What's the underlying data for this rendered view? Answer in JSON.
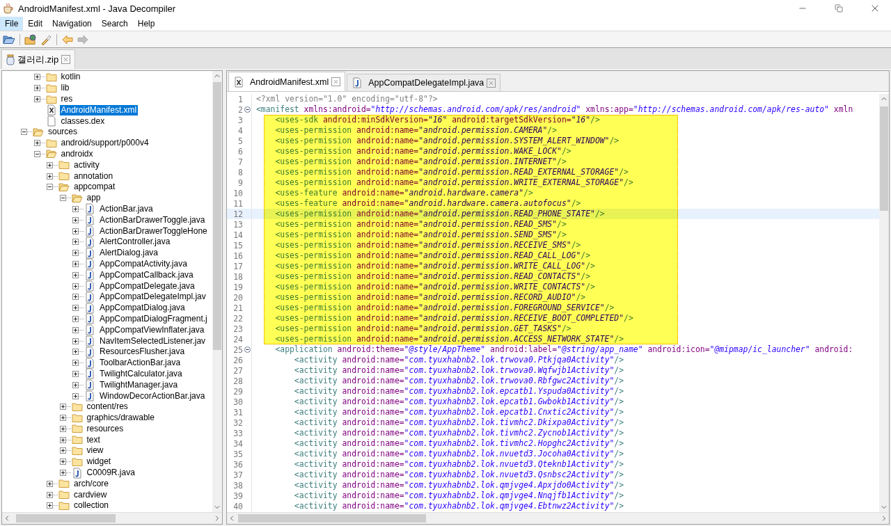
{
  "window": {
    "title": "AndroidManifest.xml - Java Decompiler"
  },
  "menu": [
    {
      "label": "File",
      "selected": true
    },
    {
      "label": "Edit",
      "selected": false
    },
    {
      "label": "Navigation",
      "selected": false
    },
    {
      "label": "Search",
      "selected": false
    },
    {
      "label": "Help",
      "selected": false
    }
  ],
  "toolbar": [
    {
      "kind": "open",
      "disabled": false
    },
    {
      "kind": "open-type",
      "disabled": false
    },
    {
      "kind": "search",
      "disabled": false
    },
    {
      "kind": "back",
      "disabled": false
    },
    {
      "kind": "forward",
      "disabled": true
    }
  ],
  "file_tab": {
    "label": "갤러리.zip"
  },
  "tree": [
    {
      "children": [
        {
          "label": "kotlin",
          "kind": "folder",
          "expanded": false,
          "selected": false
        },
        {
          "label": "lib",
          "kind": "folder",
          "expanded": false,
          "selected": false
        },
        {
          "label": "res",
          "kind": "folder",
          "expanded": false,
          "selected": false
        },
        {
          "label": "AndroidManifest.xml",
          "kind": "xml",
          "selected": true
        },
        {
          "label": "classes.dex",
          "kind": "file",
          "selected": false
        }
      ]
    },
    {
      "label": "sources",
      "kind": "folder",
      "expanded": true,
      "selected": false,
      "children": [
        {
          "label": "android/support/p000v4",
          "kind": "folder",
          "expanded": false,
          "selected": false
        },
        {
          "label": "androidx",
          "kind": "folder",
          "expanded": true,
          "selected": false,
          "children": [
            {
              "label": "activity",
              "kind": "folder",
              "expanded": false,
              "selected": false
            },
            {
              "label": "annotation",
              "kind": "folder",
              "expanded": false,
              "selected": false
            },
            {
              "label": "appcompat",
              "kind": "folder",
              "expanded": true,
              "selected": false,
              "children": [
                {
                  "label": "app",
                  "kind": "folder",
                  "expanded": true,
                  "selected": false,
                  "children": [
                    {
                      "label": "ActionBar.java",
                      "kind": "java",
                      "expanded": false,
                      "selected": false
                    },
                    {
                      "label": "ActionBarDrawerToggle.java",
                      "kind": "java",
                      "expanded": false,
                      "selected": false
                    },
                    {
                      "label": "ActionBarDrawerToggleHone",
                      "kind": "java",
                      "expanded": false,
                      "selected": false
                    },
                    {
                      "label": "AlertController.java",
                      "kind": "java",
                      "expanded": false,
                      "selected": false
                    },
                    {
                      "label": "AlertDialog.java",
                      "kind": "java",
                      "expanded": false,
                      "selected": false
                    },
                    {
                      "label": "AppCompatActivity.java",
                      "kind": "java",
                      "expanded": false,
                      "selected": false
                    },
                    {
                      "label": "AppCompatCallback.java",
                      "kind": "java",
                      "expanded": false,
                      "selected": false
                    },
                    {
                      "label": "AppCompatDelegate.java",
                      "kind": "java",
                      "expanded": false,
                      "selected": false
                    },
                    {
                      "label": "AppCompatDelegateImpl.jav",
                      "kind": "java",
                      "expanded": false,
                      "selected": false
                    },
                    {
                      "label": "AppCompatDialog.java",
                      "kind": "java",
                      "expanded": false,
                      "selected": false
                    },
                    {
                      "label": "AppCompatDialogFragment.j",
                      "kind": "java",
                      "expanded": false,
                      "selected": false
                    },
                    {
                      "label": "AppCompatViewInflater.java",
                      "kind": "java",
                      "expanded": false,
                      "selected": false
                    },
                    {
                      "label": "NavItemSelectedListener.jav",
                      "kind": "java",
                      "expanded": false,
                      "selected": false
                    },
                    {
                      "label": "ResourcesFlusher.java",
                      "kind": "java",
                      "expanded": false,
                      "selected": false
                    },
                    {
                      "label": "ToolbarActionBar.java",
                      "kind": "java",
                      "expanded": false,
                      "selected": false
                    },
                    {
                      "label": "TwilightCalculator.java",
                      "kind": "java",
                      "expanded": false,
                      "selected": false
                    },
                    {
                      "label": "TwilightManager.java",
                      "kind": "java",
                      "expanded": false,
                      "selected": false
                    },
                    {
                      "label": "WindowDecorActionBar.java",
                      "kind": "java",
                      "expanded": false,
                      "selected": false
                    }
                  ]
                },
                {
                  "label": "content/res",
                  "kind": "folder",
                  "expanded": false,
                  "selected": false
                },
                {
                  "label": "graphics/drawable",
                  "kind": "folder",
                  "expanded": false,
                  "selected": false
                },
                {
                  "label": "resources",
                  "kind": "folder",
                  "expanded": false,
                  "selected": false
                },
                {
                  "label": "text",
                  "kind": "folder",
                  "expanded": false,
                  "selected": false
                },
                {
                  "label": "view",
                  "kind": "folder",
                  "expanded": false,
                  "selected": false
                },
                {
                  "label": "widget",
                  "kind": "folder",
                  "expanded": false,
                  "selected": false
                },
                {
                  "label": "C0009R.java",
                  "kind": "java",
                  "expanded": false,
                  "selected": false
                }
              ]
            },
            {
              "label": "arch/core",
              "kind": "folder",
              "expanded": false,
              "selected": false
            },
            {
              "label": "cardview",
              "kind": "folder",
              "expanded": false,
              "selected": false
            },
            {
              "label": "collection",
              "kind": "folder",
              "expanded": false,
              "selected": false
            }
          ]
        }
      ]
    }
  ],
  "editor_tabs": [
    {
      "label": "AndroidManifest.xml",
      "kind": "xml",
      "selected": true
    },
    {
      "label": "AppCompatDelegateImpl.java",
      "kind": "java",
      "selected": false
    }
  ],
  "code": {
    "lines": [
      {
        "n": "1",
        "fold": false,
        "current": false,
        "marked": false,
        "parts": [
          {
            "kind": "pi",
            "text": "<?xml version=\"1.0\" encoding=\"utf-8\"?>"
          }
        ]
      },
      {
        "n": "2",
        "fold": true,
        "current": false,
        "marked": false,
        "parts": [
          {
            "kind": "tag",
            "text": "<manifest"
          },
          {
            "kind": "attr",
            "text": " xmlns:android="
          },
          {
            "kind": "value",
            "text": "\"http://schemas.android.com/apk/res/android\""
          },
          {
            "kind": "attr",
            "text": " xmlns:app="
          },
          {
            "kind": "value",
            "text": "\"http://schemas.android.com/apk/res-auto\""
          },
          {
            "kind": "attr",
            "text": " xmln"
          }
        ]
      },
      {
        "n": "3",
        "fold": false,
        "current": false,
        "marked": true,
        "parts": [
          {
            "kind": "tag",
            "text": "    <uses-sdk"
          },
          {
            "kind": "attr",
            "text": " android:minSdkVersion="
          },
          {
            "kind": "value",
            "text": "\"16\""
          },
          {
            "kind": "attr",
            "text": " android:targetSdkVersion="
          },
          {
            "kind": "value",
            "text": "\"16\""
          },
          {
            "kind": "tag",
            "text": "/>"
          }
        ]
      },
      {
        "n": "4",
        "fold": false,
        "current": false,
        "marked": true,
        "parts": [
          {
            "kind": "tag",
            "text": "    <uses-permission"
          },
          {
            "kind": "attr",
            "text": " android:name="
          },
          {
            "kind": "value",
            "text": "\"android.permission.CAMERA\""
          },
          {
            "kind": "tag",
            "text": "/>"
          }
        ]
      },
      {
        "n": "5",
        "fold": false,
        "current": false,
        "marked": true,
        "parts": [
          {
            "kind": "tag",
            "text": "    <uses-permission"
          },
          {
            "kind": "attr",
            "text": " android:name="
          },
          {
            "kind": "value",
            "text": "\"android.permission.SYSTEM_ALERT_WINDOW\""
          },
          {
            "kind": "tag",
            "text": "/>"
          }
        ]
      },
      {
        "n": "6",
        "fold": false,
        "current": false,
        "marked": true,
        "parts": [
          {
            "kind": "tag",
            "text": "    <uses-permission"
          },
          {
            "kind": "attr",
            "text": " android:name="
          },
          {
            "kind": "value",
            "text": "\"android.permission.WAKE_LOCK\""
          },
          {
            "kind": "tag",
            "text": "/>"
          }
        ]
      },
      {
        "n": "7",
        "fold": false,
        "current": false,
        "marked": true,
        "parts": [
          {
            "kind": "tag",
            "text": "    <uses-permission"
          },
          {
            "kind": "attr",
            "text": " android:name="
          },
          {
            "kind": "value",
            "text": "\"android.permission.INTERNET\""
          },
          {
            "kind": "tag",
            "text": "/>"
          }
        ]
      },
      {
        "n": "8",
        "fold": false,
        "current": false,
        "marked": true,
        "parts": [
          {
            "kind": "tag",
            "text": "    <uses-permission"
          },
          {
            "kind": "attr",
            "text": " android:name="
          },
          {
            "kind": "value",
            "text": "\"android.permission.READ_EXTERNAL_STORAGE\""
          },
          {
            "kind": "tag",
            "text": "/>"
          }
        ]
      },
      {
        "n": "9",
        "fold": false,
        "current": false,
        "marked": true,
        "parts": [
          {
            "kind": "tag",
            "text": "    <uses-permission"
          },
          {
            "kind": "attr",
            "text": " android:name="
          },
          {
            "kind": "value",
            "text": "\"android.permission.WRITE_EXTERNAL_STORAGE\""
          },
          {
            "kind": "tag",
            "text": "/>"
          }
        ]
      },
      {
        "n": "10",
        "fold": false,
        "current": false,
        "marked": true,
        "parts": [
          {
            "kind": "tag",
            "text": "    <uses-feature"
          },
          {
            "kind": "attr",
            "text": " android:name="
          },
          {
            "kind": "value",
            "text": "\"android.hardware.camera\""
          },
          {
            "kind": "tag",
            "text": "/>"
          }
        ]
      },
      {
        "n": "11",
        "fold": false,
        "current": false,
        "marked": true,
        "parts": [
          {
            "kind": "tag",
            "text": "    <uses-feature"
          },
          {
            "kind": "attr",
            "text": " android:name="
          },
          {
            "kind": "value",
            "text": "\"android.hardware.camera.autofocus\""
          },
          {
            "kind": "tag",
            "text": "/>"
          }
        ]
      },
      {
        "n": "12",
        "fold": false,
        "current": true,
        "marked": true,
        "parts": [
          {
            "kind": "tag",
            "text": "    <uses-permission"
          },
          {
            "kind": "attr",
            "text": " android:name="
          },
          {
            "kind": "value",
            "text": "\"android.permission.READ_PHONE_STATE\""
          },
          {
            "kind": "tag",
            "text": "/>"
          }
        ]
      },
      {
        "n": "13",
        "fold": false,
        "current": false,
        "marked": true,
        "parts": [
          {
            "kind": "tag",
            "text": "    <uses-permission"
          },
          {
            "kind": "attr",
            "text": " android:name="
          },
          {
            "kind": "value",
            "text": "\"android.permission.READ_SMS\""
          },
          {
            "kind": "tag",
            "text": "/>"
          }
        ]
      },
      {
        "n": "14",
        "fold": false,
        "current": false,
        "marked": true,
        "parts": [
          {
            "kind": "tag",
            "text": "    <uses-permission"
          },
          {
            "kind": "attr",
            "text": " android:name="
          },
          {
            "kind": "value",
            "text": "\"android.permission.SEND_SMS\""
          },
          {
            "kind": "tag",
            "text": "/>"
          }
        ]
      },
      {
        "n": "15",
        "fold": false,
        "current": false,
        "marked": true,
        "parts": [
          {
            "kind": "tag",
            "text": "    <uses-permission"
          },
          {
            "kind": "attr",
            "text": " android:name="
          },
          {
            "kind": "value",
            "text": "\"android.permission.RECEIVE_SMS\""
          },
          {
            "kind": "tag",
            "text": "/>"
          }
        ]
      },
      {
        "n": "16",
        "fold": false,
        "current": false,
        "marked": true,
        "parts": [
          {
            "kind": "tag",
            "text": "    <uses-permission"
          },
          {
            "kind": "attr",
            "text": " android:name="
          },
          {
            "kind": "value",
            "text": "\"android.permission.READ_CALL_LOG\""
          },
          {
            "kind": "tag",
            "text": "/>"
          }
        ]
      },
      {
        "n": "17",
        "fold": false,
        "current": false,
        "marked": true,
        "parts": [
          {
            "kind": "tag",
            "text": "    <uses-permission"
          },
          {
            "kind": "attr",
            "text": " android:name="
          },
          {
            "kind": "value",
            "text": "\"android.permission.WRITE_CALL_LOG\""
          },
          {
            "kind": "tag",
            "text": "/>"
          }
        ]
      },
      {
        "n": "18",
        "fold": false,
        "current": false,
        "marked": true,
        "parts": [
          {
            "kind": "tag",
            "text": "    <uses-permission"
          },
          {
            "kind": "attr",
            "text": " android:name="
          },
          {
            "kind": "value",
            "text": "\"android.permission.READ_CONTACTS\""
          },
          {
            "kind": "tag",
            "text": "/>"
          }
        ]
      },
      {
        "n": "19",
        "fold": false,
        "current": false,
        "marked": true,
        "parts": [
          {
            "kind": "tag",
            "text": "    <uses-permission"
          },
          {
            "kind": "attr",
            "text": " android:name="
          },
          {
            "kind": "value",
            "text": "\"android.permission.WRITE_CONTACTS\""
          },
          {
            "kind": "tag",
            "text": "/>"
          }
        ]
      },
      {
        "n": "20",
        "fold": false,
        "current": false,
        "marked": true,
        "parts": [
          {
            "kind": "tag",
            "text": "    <uses-permission"
          },
          {
            "kind": "attr",
            "text": " android:name="
          },
          {
            "kind": "value",
            "text": "\"android.permission.RECORD_AUDIO\""
          },
          {
            "kind": "tag",
            "text": "/>"
          }
        ]
      },
      {
        "n": "21",
        "fold": false,
        "current": false,
        "marked": true,
        "parts": [
          {
            "kind": "tag",
            "text": "    <uses-permission"
          },
          {
            "kind": "attr",
            "text": " android:name="
          },
          {
            "kind": "value",
            "text": "\"android.permission.FOREGROUND_SERVICE\""
          },
          {
            "kind": "tag",
            "text": "/>"
          }
        ]
      },
      {
        "n": "22",
        "fold": false,
        "current": false,
        "marked": true,
        "parts": [
          {
            "kind": "tag",
            "text": "    <uses-permission"
          },
          {
            "kind": "attr",
            "text": " android:name="
          },
          {
            "kind": "value",
            "text": "\"android.permission.RECEIVE_BOOT_COMPLETED\""
          },
          {
            "kind": "tag",
            "text": "/>"
          }
        ]
      },
      {
        "n": "23",
        "fold": false,
        "current": false,
        "marked": true,
        "parts": [
          {
            "kind": "tag",
            "text": "    <uses-permission"
          },
          {
            "kind": "attr",
            "text": " android:name="
          },
          {
            "kind": "value",
            "text": "\"android.permission.GET_TASKS\""
          },
          {
            "kind": "tag",
            "text": "/>"
          }
        ]
      },
      {
        "n": "24",
        "fold": false,
        "current": false,
        "marked": true,
        "parts": [
          {
            "kind": "tag",
            "text": "    <uses-permission"
          },
          {
            "kind": "attr",
            "text": " android:name="
          },
          {
            "kind": "value",
            "text": "\"android.permission.ACCESS_NETWORK_STATE\""
          },
          {
            "kind": "tag",
            "text": "/>"
          }
        ]
      },
      {
        "n": "25",
        "fold": true,
        "current": false,
        "marked": false,
        "parts": [
          {
            "kind": "tag",
            "text": "    <application"
          },
          {
            "kind": "attr",
            "text": " android:theme="
          },
          {
            "kind": "value",
            "text": "\"@style/AppTheme\""
          },
          {
            "kind": "attr",
            "text": " android:label="
          },
          {
            "kind": "value",
            "text": "\"@string/app_name\""
          },
          {
            "kind": "attr",
            "text": " android:icon="
          },
          {
            "kind": "value",
            "text": "\"@mipmap/ic_launcher\""
          },
          {
            "kind": "attr",
            "text": " android:"
          }
        ]
      },
      {
        "n": "26",
        "fold": false,
        "current": false,
        "marked": false,
        "parts": [
          {
            "kind": "tag",
            "text": "        <activity"
          },
          {
            "kind": "attr",
            "text": " android:name="
          },
          {
            "kind": "value",
            "text": "\"com.tyuxhabnb2.lok.trwova0.Ptkjqa0Activity\""
          },
          {
            "kind": "tag",
            "text": "/>"
          }
        ]
      },
      {
        "n": "27",
        "fold": false,
        "current": false,
        "marked": false,
        "parts": [
          {
            "kind": "tag",
            "text": "        <activity"
          },
          {
            "kind": "attr",
            "text": " android:name="
          },
          {
            "kind": "value",
            "text": "\"com.tyuxhabnb2.lok.trwova0.Wqfwjb1Activity\""
          },
          {
            "kind": "tag",
            "text": "/>"
          }
        ]
      },
      {
        "n": "28",
        "fold": false,
        "current": false,
        "marked": false,
        "parts": [
          {
            "kind": "tag",
            "text": "        <activity"
          },
          {
            "kind": "attr",
            "text": " android:name="
          },
          {
            "kind": "value",
            "text": "\"com.tyuxhabnb2.lok.trwova0.Rbfgwc2Activity\""
          },
          {
            "kind": "tag",
            "text": "/>"
          }
        ]
      },
      {
        "n": "29",
        "fold": false,
        "current": false,
        "marked": false,
        "parts": [
          {
            "kind": "tag",
            "text": "        <activity"
          },
          {
            "kind": "attr",
            "text": " android:name="
          },
          {
            "kind": "value",
            "text": "\"com.tyuxhabnb2.lok.epcatb1.Yspuda0Activity\""
          },
          {
            "kind": "tag",
            "text": "/>"
          }
        ]
      },
      {
        "n": "30",
        "fold": false,
        "current": false,
        "marked": false,
        "parts": [
          {
            "kind": "tag",
            "text": "        <activity"
          },
          {
            "kind": "attr",
            "text": " android:name="
          },
          {
            "kind": "value",
            "text": "\"com.tyuxhabnb2.lok.epcatb1.Gwbokb1Activity\""
          },
          {
            "kind": "tag",
            "text": "/>"
          }
        ]
      },
      {
        "n": "31",
        "fold": false,
        "current": false,
        "marked": false,
        "parts": [
          {
            "kind": "tag",
            "text": "        <activity"
          },
          {
            "kind": "attr",
            "text": " android:name="
          },
          {
            "kind": "value",
            "text": "\"com.tyuxhabnb2.lok.epcatb1.Cnxtic2Activity\""
          },
          {
            "kind": "tag",
            "text": "/>"
          }
        ]
      },
      {
        "n": "32",
        "fold": false,
        "current": false,
        "marked": false,
        "parts": [
          {
            "kind": "tag",
            "text": "        <activity"
          },
          {
            "kind": "attr",
            "text": " android:name="
          },
          {
            "kind": "value",
            "text": "\"com.tyuxhabnb2.lok.tivmhc2.Dkixpa0Activity\""
          },
          {
            "kind": "tag",
            "text": "/>"
          }
        ]
      },
      {
        "n": "33",
        "fold": false,
        "current": false,
        "marked": false,
        "parts": [
          {
            "kind": "tag",
            "text": "        <activity"
          },
          {
            "kind": "attr",
            "text": " android:name="
          },
          {
            "kind": "value",
            "text": "\"com.tyuxhabnb2.lok.tivmhc2.Zycnob1Activity\""
          },
          {
            "kind": "tag",
            "text": "/>"
          }
        ]
      },
      {
        "n": "34",
        "fold": false,
        "current": false,
        "marked": false,
        "parts": [
          {
            "kind": "tag",
            "text": "        <activity"
          },
          {
            "kind": "attr",
            "text": " android:name="
          },
          {
            "kind": "value",
            "text": "\"com.tyuxhabnb2.lok.tivmhc2.Hopghc2Activity\""
          },
          {
            "kind": "tag",
            "text": "/>"
          }
        ]
      },
      {
        "n": "35",
        "fold": false,
        "current": false,
        "marked": false,
        "parts": [
          {
            "kind": "tag",
            "text": "        <activity"
          },
          {
            "kind": "attr",
            "text": " android:name="
          },
          {
            "kind": "value",
            "text": "\"com.tyuxhabnb2.lok.nvuetd3.Jocoha0Activity\""
          },
          {
            "kind": "tag",
            "text": "/>"
          }
        ]
      },
      {
        "n": "36",
        "fold": false,
        "current": false,
        "marked": false,
        "parts": [
          {
            "kind": "tag",
            "text": "        <activity"
          },
          {
            "kind": "attr",
            "text": " android:name="
          },
          {
            "kind": "value",
            "text": "\"com.tyuxhabnb2.lok.nvuetd3.Qteknb1Activity\""
          },
          {
            "kind": "tag",
            "text": "/>"
          }
        ]
      },
      {
        "n": "37",
        "fold": false,
        "current": false,
        "marked": false,
        "parts": [
          {
            "kind": "tag",
            "text": "        <activity"
          },
          {
            "kind": "attr",
            "text": " android:name="
          },
          {
            "kind": "value",
            "text": "\"com.tyuxhabnb2.lok.nvuetd3.Qsnbsc2Activity\""
          },
          {
            "kind": "tag",
            "text": "/>"
          }
        ]
      },
      {
        "n": "38",
        "fold": false,
        "current": false,
        "marked": false,
        "parts": [
          {
            "kind": "tag",
            "text": "        <activity"
          },
          {
            "kind": "attr",
            "text": " android:name="
          },
          {
            "kind": "value",
            "text": "\"com.tyuxhabnb2.lok.qmjvge4.Apxjdo0Activity\""
          },
          {
            "kind": "tag",
            "text": "/>"
          }
        ]
      },
      {
        "n": "39",
        "fold": false,
        "current": false,
        "marked": false,
        "parts": [
          {
            "kind": "tag",
            "text": "        <activity"
          },
          {
            "kind": "attr",
            "text": " android:name="
          },
          {
            "kind": "value",
            "text": "\"com.tyuxhabnb2.lok.qmjvge4.Nnqjfb1Activity\""
          },
          {
            "kind": "tag",
            "text": "/>"
          }
        ]
      },
      {
        "n": "40",
        "fold": false,
        "current": false,
        "marked": false,
        "parts": [
          {
            "kind": "tag",
            "text": "        <activity"
          },
          {
            "kind": "attr",
            "text": " android:name="
          },
          {
            "kind": "value",
            "text": "\"com.tyuxhabnb2.lok.qmjvge4.Ebtnwz2Activity\""
          },
          {
            "kind": "tag",
            "text": "/>"
          }
        ]
      }
    ]
  }
}
